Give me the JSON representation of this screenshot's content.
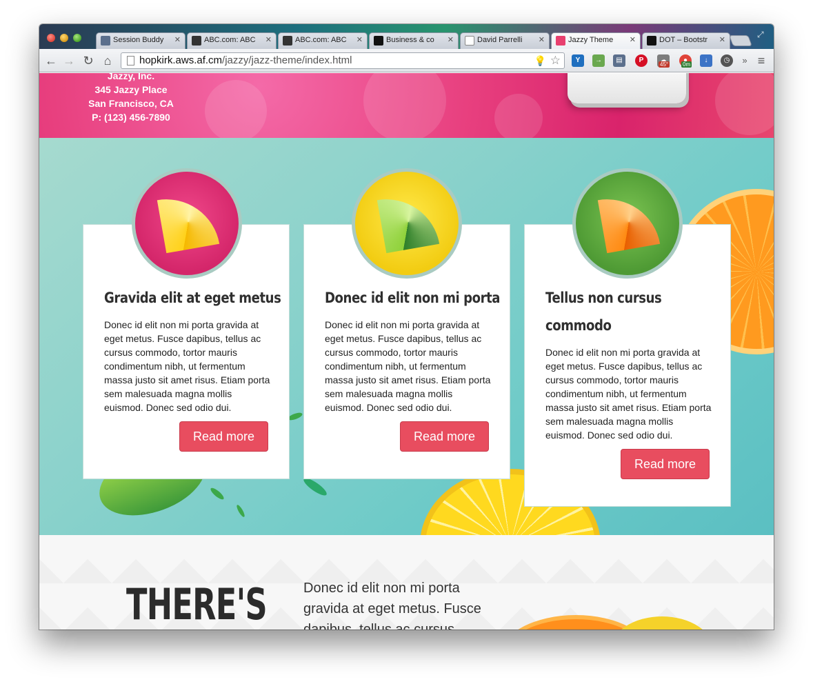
{
  "browser": {
    "tabs": [
      {
        "label": "Session Buddy",
        "color": "#5b6f8c"
      },
      {
        "label": "ABC.com: ABC",
        "color": "#333333"
      },
      {
        "label": "ABC.com: ABC",
        "color": "#333333"
      },
      {
        "label": "Business & co",
        "color": "#111111"
      },
      {
        "label": "David Parrelli",
        "color": "#ffffff"
      },
      {
        "label": "Jazzy Theme",
        "color": "#e8406f"
      },
      {
        "label": "DOT – Bootstr",
        "color": "#111111"
      }
    ],
    "active_tab_index": 5,
    "url": {
      "host": "hopkirk.aws.af.cm",
      "path": "/jazzy/jazz-theme/index.html"
    },
    "extension_badges": {
      "weather": "45°",
      "timer": "0m"
    }
  },
  "hero": {
    "address_lines": [
      "Jazzy, Inc.",
      "345 Jazzy Place",
      "San Francisco, CA",
      "P: (123) 456-7890"
    ]
  },
  "cards": [
    {
      "title_lines": [
        "Gravida elit at eget metus"
      ],
      "body": "Donec id elit non mi porta gravida at eget metus. Fusce dapibus, tellus ac cursus commodo, tortor mauris condimentum nibh, ut fermentum massa justo sit amet risus. Etiam porta sem malesuada magna mollis euismod. Donec sed odio dui.",
      "button": "Read more",
      "circle_color": "#e0306f",
      "fruit": "lemon-slice"
    },
    {
      "title_lines": [
        "Donec id elit non mi porta"
      ],
      "body": "Donec id elit non mi porta gravida at eget metus. Fusce dapibus, tellus ac cursus commodo, tortor mauris condimentum nibh, ut fermentum massa justo sit amet risus. Etiam porta sem malesuada magna mollis euismod. Donec sed odio dui.",
      "button": "Read more",
      "circle_color": "#f2d21c",
      "fruit": "lime-slice"
    },
    {
      "title_lines": [
        "Tellus non cursus",
        "commodo"
      ],
      "body": "Donec id elit non mi porta gravida at eget metus. Fusce dapibus, tellus ac cursus commodo, tortor mauris condimentum nibh, ut fermentum massa justo sit amet risus. Etiam porta sem malesuada magna mollis euismod. Donec sed odio dui.",
      "button": "Read more",
      "circle_color": "#5aa83c",
      "fruit": "orange-slice"
    }
  ],
  "bottom": {
    "heading": "THERE'S",
    "text": "Donec id elit non mi porta gravida at eget metus. Fusce dapibus, tellus ac cursus"
  },
  "colors": {
    "accent": "#e84d5f",
    "hero_pink": "#e8407f",
    "feature_teal": "#88d1cb"
  }
}
